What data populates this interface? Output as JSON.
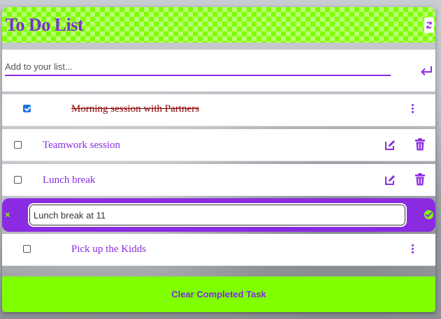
{
  "header": {
    "title": "To Do List",
    "refresh_icon": "refresh-icon"
  },
  "add_task": {
    "placeholder": "Add to your list...",
    "value": "",
    "submit_icon": "enter-arrow-icon"
  },
  "tasks": [
    {
      "text": "Morning session with Partners",
      "completed": true
    },
    {
      "text": "Teamwork session",
      "completed": false
    },
    {
      "text": "Lunch break",
      "completed": false
    },
    {
      "text": "Pick up the Kidds",
      "completed": false
    }
  ],
  "edit": {
    "value": "Lunch break at 11",
    "cancel_label": "×",
    "cancel_icon": "close-icon",
    "confirm_icon": "check-circle-icon"
  },
  "footer": {
    "clear_label": "Clear Completed Task"
  },
  "colors": {
    "accent": "#8a2be2",
    "header_green": "#7fff00",
    "done_text": "#8b0000",
    "checkbox_blue": "#1a73e8"
  }
}
